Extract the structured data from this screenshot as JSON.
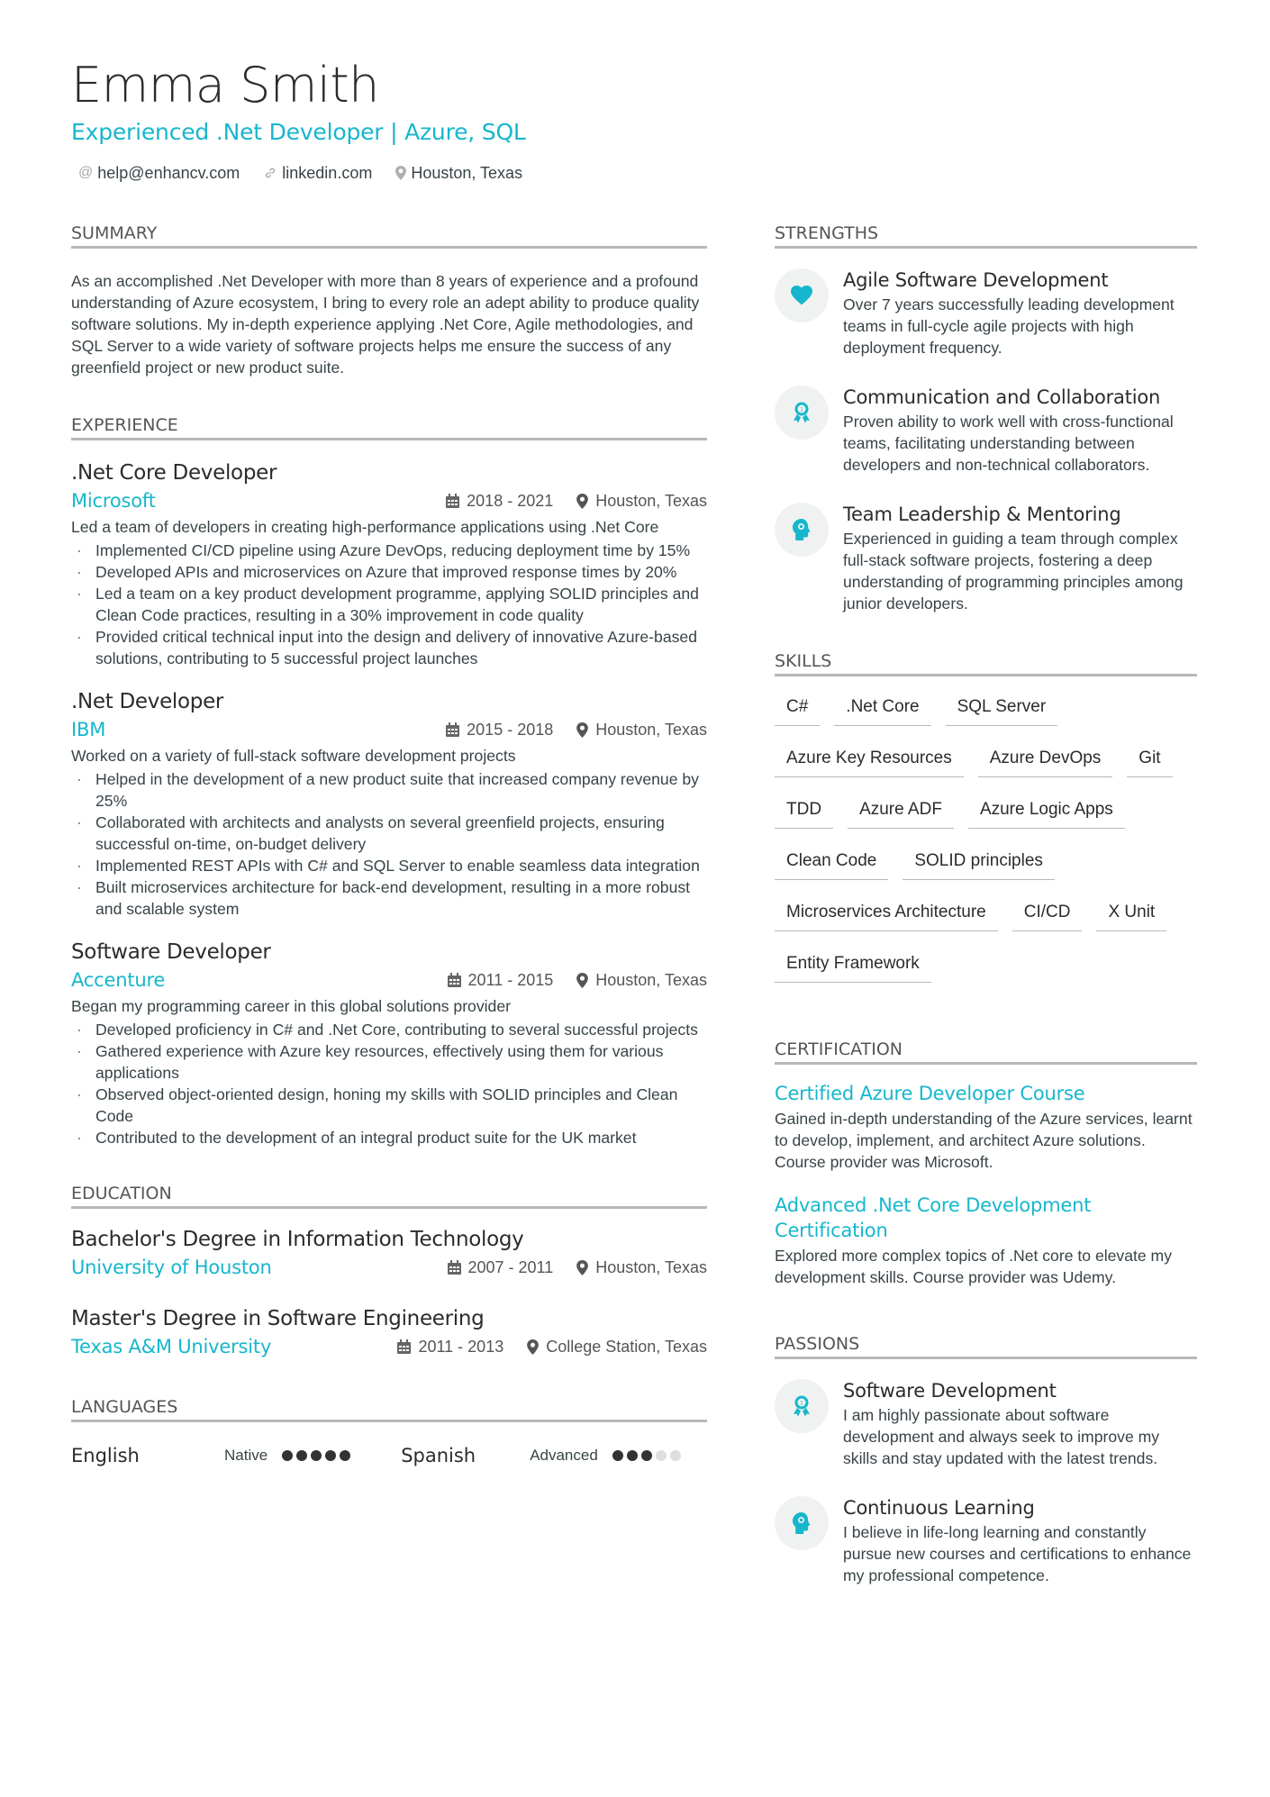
{
  "header": {
    "name": "Emma Smith",
    "headline": "Experienced .Net Developer | Azure, SQL",
    "contacts": [
      {
        "icon": "at-icon",
        "text": "help@enhancv.com"
      },
      {
        "icon": "link-icon",
        "text": "linkedin.com"
      },
      {
        "icon": "location-pin-icon",
        "text": "Houston, Texas"
      }
    ]
  },
  "colors": {
    "accent": "#16b7cc",
    "text": "#384347",
    "heading": "#2b2b2b",
    "rule": "#b6b8ba",
    "icon_bg": "#f0f2f2"
  },
  "summary": {
    "title": "Summary",
    "text": "As an accomplished .Net Developer with more than 8 years of experience and a profound understanding of Azure ecosystem, I bring to every role an adept ability to produce quality software solutions. My in-depth experience applying .Net Core, Agile methodologies, and SQL Server to a wide variety of software projects helps me ensure the success of any greenfield project or new product suite."
  },
  "experience": {
    "title": "Experience",
    "items": [
      {
        "role": ".Net Core Developer",
        "company": "Microsoft",
        "dates": "2018 - 2021",
        "location": "Houston, Texas",
        "description": "Led a team of developers in creating high-performance applications using .Net Core",
        "bullets": [
          "Implemented CI/CD pipeline using Azure DevOps, reducing deployment time by 15%",
          "Developed APIs and microservices on Azure that improved response times by 20%",
          "Led a team on a key product development programme, applying SOLID principles and Clean Code practices, resulting in a 30% improvement in code quality",
          "Provided critical technical input into the design and delivery of innovative Azure-based solutions, contributing to 5 successful project launches"
        ]
      },
      {
        "role": ".Net Developer",
        "company": "IBM",
        "dates": "2015 - 2018",
        "location": "Houston, Texas",
        "description": "Worked on a variety of full-stack software development projects",
        "bullets": [
          "Helped in the development of a new product suite that increased company revenue by 25%",
          "Collaborated with architects and analysts on several greenfield projects, ensuring successful on-time, on-budget delivery",
          "Implemented REST APIs with C# and SQL Server to enable seamless data integration",
          "Built microservices architecture for back-end development, resulting in a more robust and scalable system"
        ]
      },
      {
        "role": "Software Developer",
        "company": "Accenture",
        "dates": "2011 - 2015",
        "location": "Houston, Texas",
        "description": "Began my programming career in this global solutions provider",
        "bullets": [
          "Developed proficiency in C# and .Net Core, contributing to several successful projects",
          "Gathered experience with Azure key resources, effectively using them for various applications",
          "Observed object-oriented design, honing my skills with SOLID principles and Clean Code",
          "Contributed to the development of an integral product suite for the UK market"
        ]
      }
    ]
  },
  "education": {
    "title": "Education",
    "items": [
      {
        "degree": "Bachelor's Degree in Information Technology",
        "school": "University of Houston",
        "dates": "2007 - 2011",
        "location": "Houston, Texas"
      },
      {
        "degree": "Master's Degree in Software Engineering",
        "school": "Texas A&M University",
        "dates": "2011 - 2013",
        "location": "College Station, Texas"
      }
    ]
  },
  "languages": {
    "title": "Languages",
    "items": [
      {
        "name": "English",
        "level": "Native",
        "rating": 5,
        "max": 5
      },
      {
        "name": "Spanish",
        "level": "Advanced",
        "rating": 3,
        "max": 5
      }
    ]
  },
  "strengths": {
    "title": "Strengths",
    "items": [
      {
        "icon": "heart-icon",
        "title": "Agile Software Development",
        "text": "Over 7 years successfully leading development teams in full-cycle agile projects with high deployment frequency."
      },
      {
        "icon": "award-ribbon-icon",
        "title": "Communication and Collaboration",
        "text": "Proven ability to work well with cross-functional teams, facilitating understanding between developers and non-technical collaborators."
      },
      {
        "icon": "head-brain-icon",
        "title": "Team Leadership & Mentoring",
        "text": "Experienced in guiding a team through complex full-stack software projects, fostering a deep understanding of programming principles among junior developers."
      }
    ]
  },
  "skills": {
    "title": "Skills",
    "items": [
      "C#",
      ".Net Core",
      "SQL Server",
      "Azure Key Resources",
      "Azure DevOps",
      "Git",
      "TDD",
      "Azure ADF",
      "Azure Logic Apps",
      "Clean Code",
      "SOLID principles",
      "Microservices Architecture",
      "CI/CD",
      "X Unit",
      "Entity Framework"
    ]
  },
  "certification": {
    "title": "Certification",
    "items": [
      {
        "title": "Certified Azure Developer Course",
        "text": "Gained in-depth understanding of the Azure services, learnt to develop, implement, and architect Azure solutions. Course provider was Microsoft."
      },
      {
        "title": "Advanced .Net Core Development Certification",
        "text": "Explored more complex topics of .Net core to elevate my development skills. Course provider was Udemy."
      }
    ]
  },
  "passions": {
    "title": "Passions",
    "items": [
      {
        "icon": "award-ribbon-icon",
        "title": "Software Development",
        "text": "I am highly passionate about software development and always seek to improve my skills and stay updated with the latest trends."
      },
      {
        "icon": "head-brain-icon",
        "title": "Continuous Learning",
        "text": "I believe in life-long learning and constantly pursue new courses and certifications to enhance my professional competence."
      }
    ]
  }
}
